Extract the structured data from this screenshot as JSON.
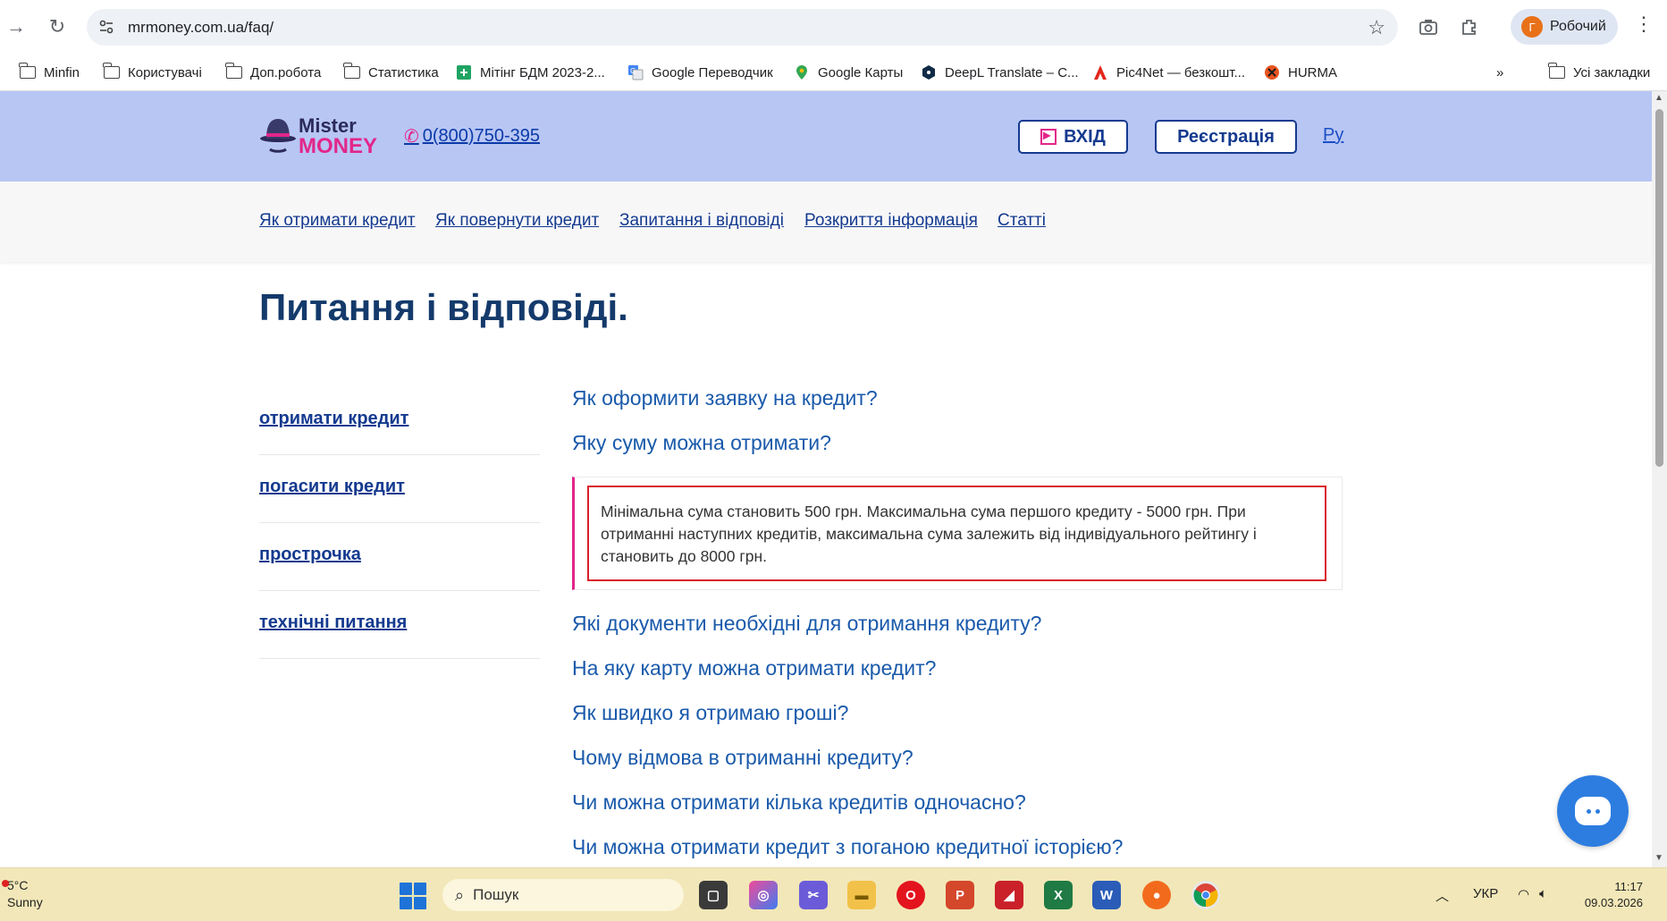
{
  "browser": {
    "url": "mrmoney.com.ua/faq/",
    "profile_initial": "Г",
    "profile_name": "Робочий"
  },
  "bookmarks": [
    {
      "label": "Minfin",
      "icon": "folder-icon"
    },
    {
      "label": "Користувачі",
      "icon": "folder-icon"
    },
    {
      "label": "Доп.робота",
      "icon": "folder-icon"
    },
    {
      "label": "Статистика",
      "icon": "folder-icon"
    },
    {
      "label": "Мітінг БДМ 2023-2...",
      "icon": "sheets-icon"
    },
    {
      "label": "Google Переводчик",
      "icon": "translate-icon"
    },
    {
      "label": "Google Карты",
      "icon": "maps-pin-icon"
    },
    {
      "label": "DeepL Translate – С...",
      "icon": "deepl-icon"
    },
    {
      "label": "Pic4Net — безкошт...",
      "icon": "pic4net-icon"
    },
    {
      "label": "HURMA",
      "icon": "hurma-icon"
    }
  ],
  "bookmarks_all": "Усі закладки",
  "site": {
    "logo_line1": "Mister",
    "logo_line2": "MONEY",
    "phone": "0(800)750-395",
    "login": "ВХІД",
    "register": "Реєстрація",
    "lang": "Ру",
    "nav": [
      "Як отримати кредит",
      "Як повернути кредит",
      "Запитання і відповіді",
      "Розкриття інформація",
      "Статті"
    ],
    "title": "Питання і відповіді.",
    "sidebar": [
      "отримати кредит",
      "погасити кредит",
      "прострочка",
      "технічні питання"
    ],
    "questions": [
      "Як оформити заявку на кредит?",
      "Яку суму можна отримати?",
      "Які документи необхідні для отримання кредиту?",
      "На яку карту можна отримати кредит?",
      "Як швидко я отримаю гроші?",
      "Чому відмова в отриманні кредиту?",
      "Чи можна отримати кілька кредитів одночасно?",
      "Чи можна отримати кредит з поганою кредитної історією?"
    ],
    "answer": "Мінімальна сума становить 500 грн. Максимальна сума першого кредиту - 5000 грн. При отриманні наступних кредитів, максимальна сума залежить від індивідуального рейтингу і становить до 8000 грн."
  },
  "taskbar": {
    "temp": "5°C",
    "weather": "Sunny",
    "search": "Пошук",
    "lang": "УКР",
    "time": "11:17",
    "date": "09.03.2026"
  }
}
